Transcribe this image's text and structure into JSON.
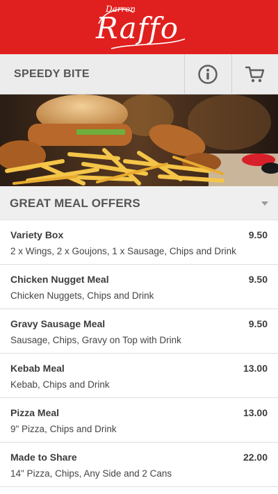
{
  "brand": {
    "small_text": "Darren",
    "main_text": "Raffo",
    "color": "#e0201e"
  },
  "navbar": {
    "store_name": "SPEEDY BITE",
    "info_icon": "info-icon",
    "cart_icon": "cart-icon"
  },
  "hero": {
    "icon": "food-photo"
  },
  "section": {
    "title": "GREAT MEAL OFFERS",
    "toggle_icon": "chevron-down-icon"
  },
  "menu_items": [
    {
      "name": "Variety Box",
      "price": "9.50",
      "description": "2 x Wings, 2 x Goujons, 1 x Sausage, Chips and Drink"
    },
    {
      "name": "Chicken Nugget Meal",
      "price": "9.50",
      "description": "Chicken Nuggets, Chips and Drink"
    },
    {
      "name": "Gravy Sausage Meal",
      "price": "9.50",
      "description": "Sausage, Chips, Gravy on Top with Drink"
    },
    {
      "name": "Kebab Meal",
      "price": "13.00",
      "description": "Kebab, Chips and Drink"
    },
    {
      "name": "Pizza Meal",
      "price": "13.00",
      "description": "9\" Pizza, Chips and Drink"
    },
    {
      "name": "Made to Share",
      "price": "22.00",
      "description": "14\" Pizza, Chips, Any Side and 2 Cans"
    }
  ]
}
